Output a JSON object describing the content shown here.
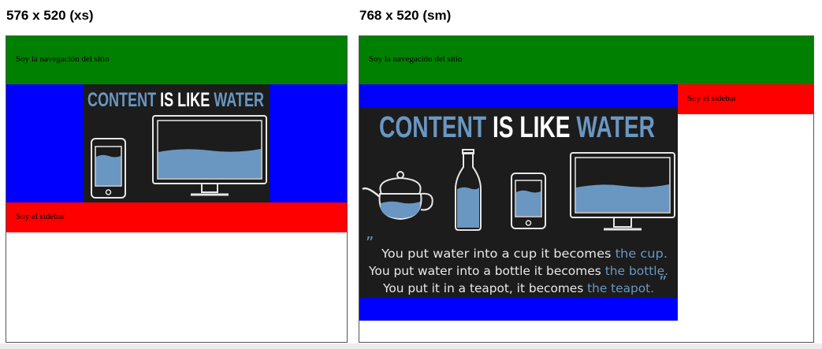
{
  "panels": [
    {
      "heading": "576 x 520 (xs)",
      "nav_text": "Soy la navegación del sitio",
      "sidebar_text": "Soy el sidebar"
    },
    {
      "heading": "768 x 520 (sm)",
      "nav_text": "Soy la navegación del sitio",
      "sidebar_text": "Soy el sidebar"
    }
  ],
  "poster": {
    "title_part1": "CONTENT",
    "title_part2": "IS LIKE",
    "title_part3": "WATER",
    "quote_line1_a": "You put water into a cup it becomes",
    "quote_line1_b": "the cup.",
    "quote_line2_a": "You put water into a bottle it becomes",
    "quote_line2_b": "the bottle.",
    "quote_line3_a": "You put it in a teapot, it becomes",
    "quote_line3_b": "the teapot.",
    "quote_mark": "”"
  },
  "colors": {
    "nav": "#008000",
    "content": "#0000ff",
    "sidebar": "#ff0000",
    "poster_bg": "#1c1c1c",
    "water": "#6a97c2",
    "title_blue": "#6a97c2"
  }
}
